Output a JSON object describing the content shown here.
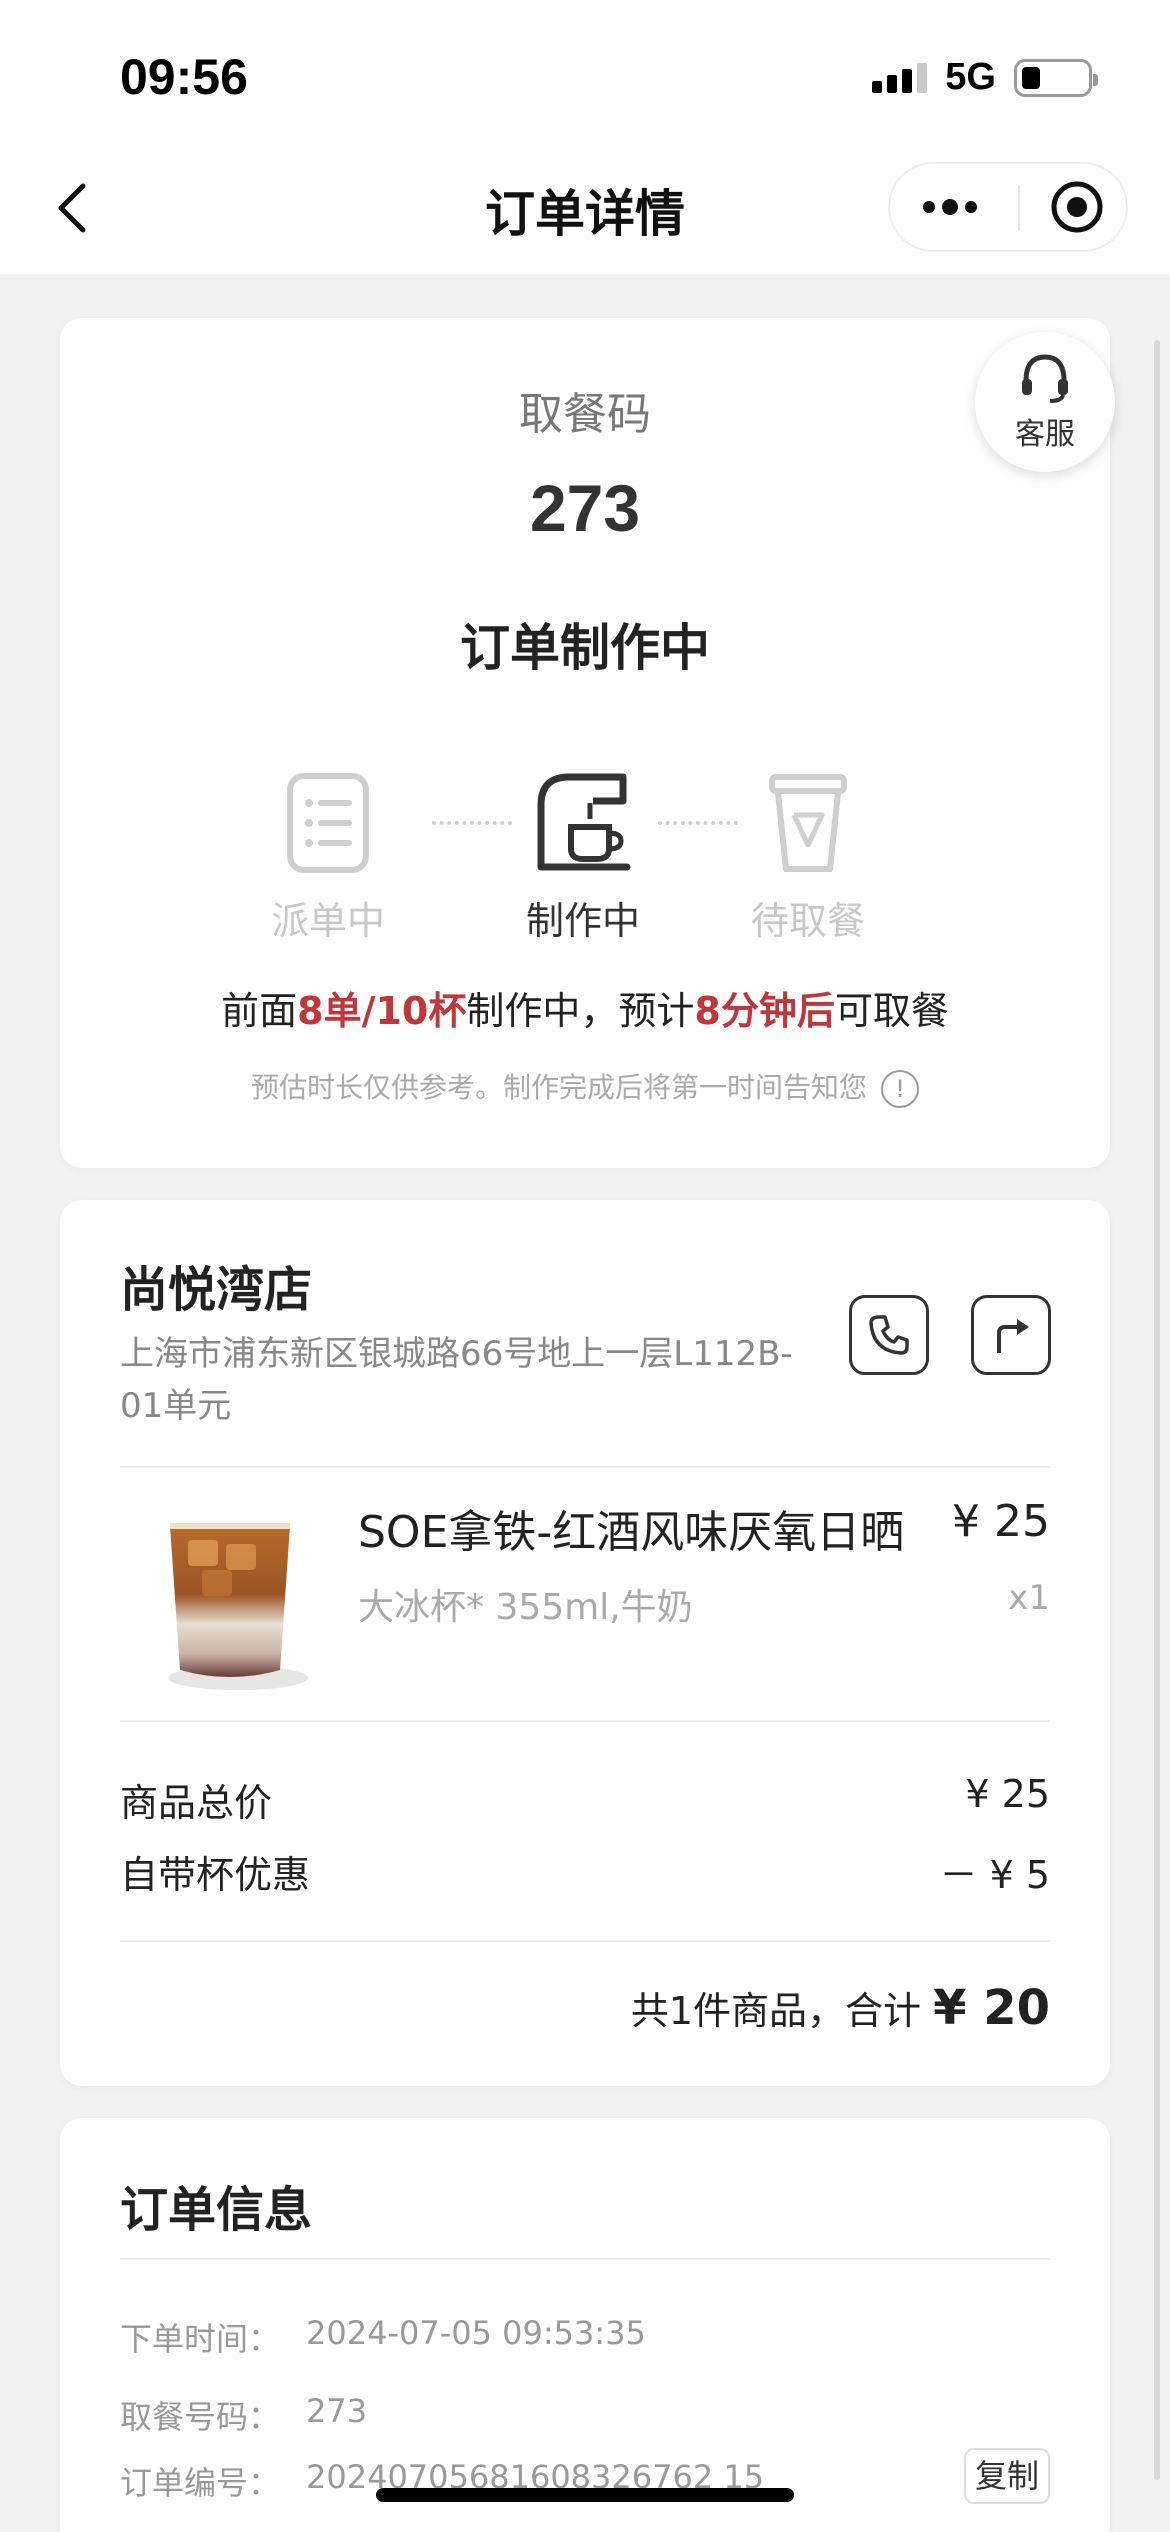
{
  "status_bar": {
    "time": "09:56",
    "network": "5G"
  },
  "navbar": {
    "title": "订单详情"
  },
  "customer_service": {
    "label": "客服"
  },
  "pickup": {
    "label": "取餐码",
    "code": "273",
    "status": "订单制作中",
    "steps": [
      {
        "label": "派单中",
        "state": "done"
      },
      {
        "label": "制作中",
        "state": "active"
      },
      {
        "label": "待取餐",
        "state": "pending"
      }
    ],
    "eta": {
      "prefix": "前面",
      "queue": "8单/10杯",
      "middle": "制作中，预计",
      "time": "8分钟后",
      "suffix": "可取餐"
    },
    "note": "预估时长仅供参考。制作完成后将第一时间告知您"
  },
  "store": {
    "name": "尚悦湾店",
    "address": "上海市浦东新区银城路66号地上一层L112B-01单元",
    "item": {
      "name": "SOE拿铁-红酒风味厌氧日晒",
      "price": "¥ 25",
      "spec": "大冰杯* 355ml,牛奶",
      "qty": "x1"
    },
    "subtotal_label": "商品总价",
    "subtotal_value": "¥ 25",
    "discount_label": "自带杯优惠",
    "discount_value": "－ ¥ 5",
    "total_prefix": "共1件商品，合计",
    "total_amount": "¥ 20"
  },
  "order_info": {
    "title": "订单信息",
    "order_time_label": "下单时间：",
    "order_time": "2024-07-05 09:53:35",
    "pickup_no_label": "取餐号码：",
    "pickup_no": "273",
    "order_no_label": "订单编号：",
    "order_no": "20240705681608326762 15",
    "copy_label": "复制"
  },
  "colors": {
    "accent_red": "#c0363a",
    "background": "#f2f2f2"
  }
}
